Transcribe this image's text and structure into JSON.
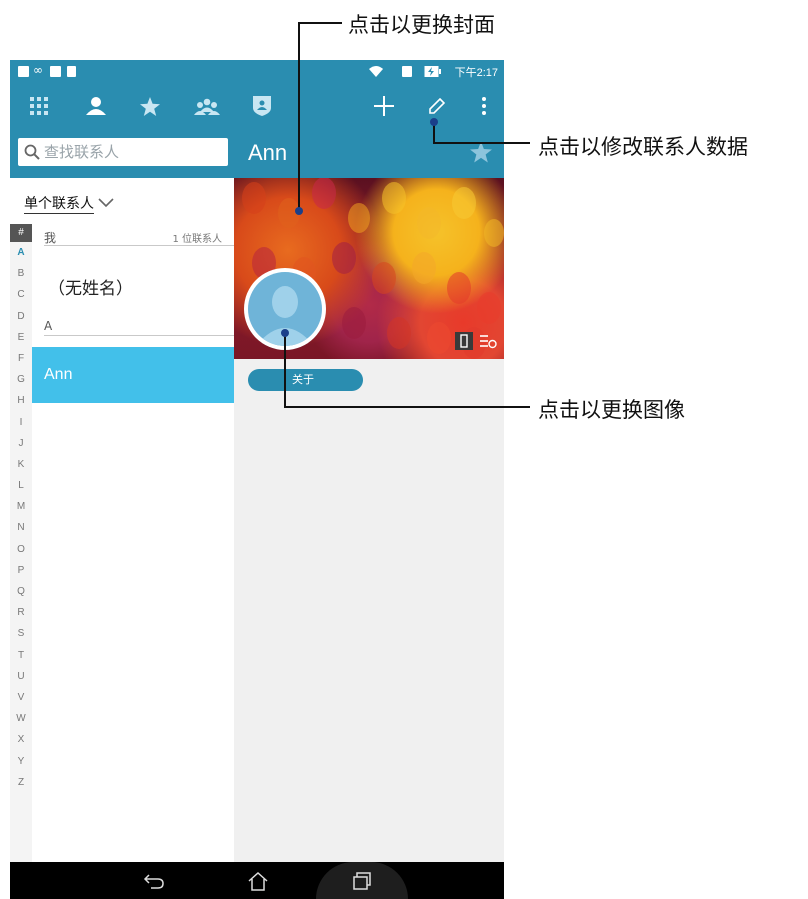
{
  "status_bar": {
    "time": "下午2:17"
  },
  "action_bar": {
    "icons": [
      "grid-icon",
      "person-icon",
      "star-icon",
      "group-icon",
      "shield-icon",
      "add-icon",
      "edit-icon",
      "overflow-icon"
    ]
  },
  "search": {
    "placeholder": "查找联系人"
  },
  "detail": {
    "contact_name": "Ann",
    "about_tab": "关于"
  },
  "list": {
    "filter_label": "单个联系人",
    "me_header": "我",
    "me_count": "1 位联系人",
    "me_entry": "（无姓名）",
    "section_a": "A",
    "selected_contact": "Ann",
    "index": [
      "#",
      "A",
      "B",
      "C",
      "D",
      "E",
      "F",
      "G",
      "H",
      "I",
      "J",
      "K",
      "L",
      "M",
      "N",
      "O",
      "P",
      "Q",
      "R",
      "S",
      "T",
      "U",
      "V",
      "W",
      "X",
      "Y",
      "Z"
    ]
  },
  "callouts": {
    "change_cover": "点击以更换封面",
    "edit_contact": "点击以修改联系人数据",
    "change_photo": "点击以更换图像"
  },
  "colors": {
    "accent": "#2a8db0",
    "selected_row": "#42c0ea",
    "pointer_dot": "#1a3f8a"
  }
}
